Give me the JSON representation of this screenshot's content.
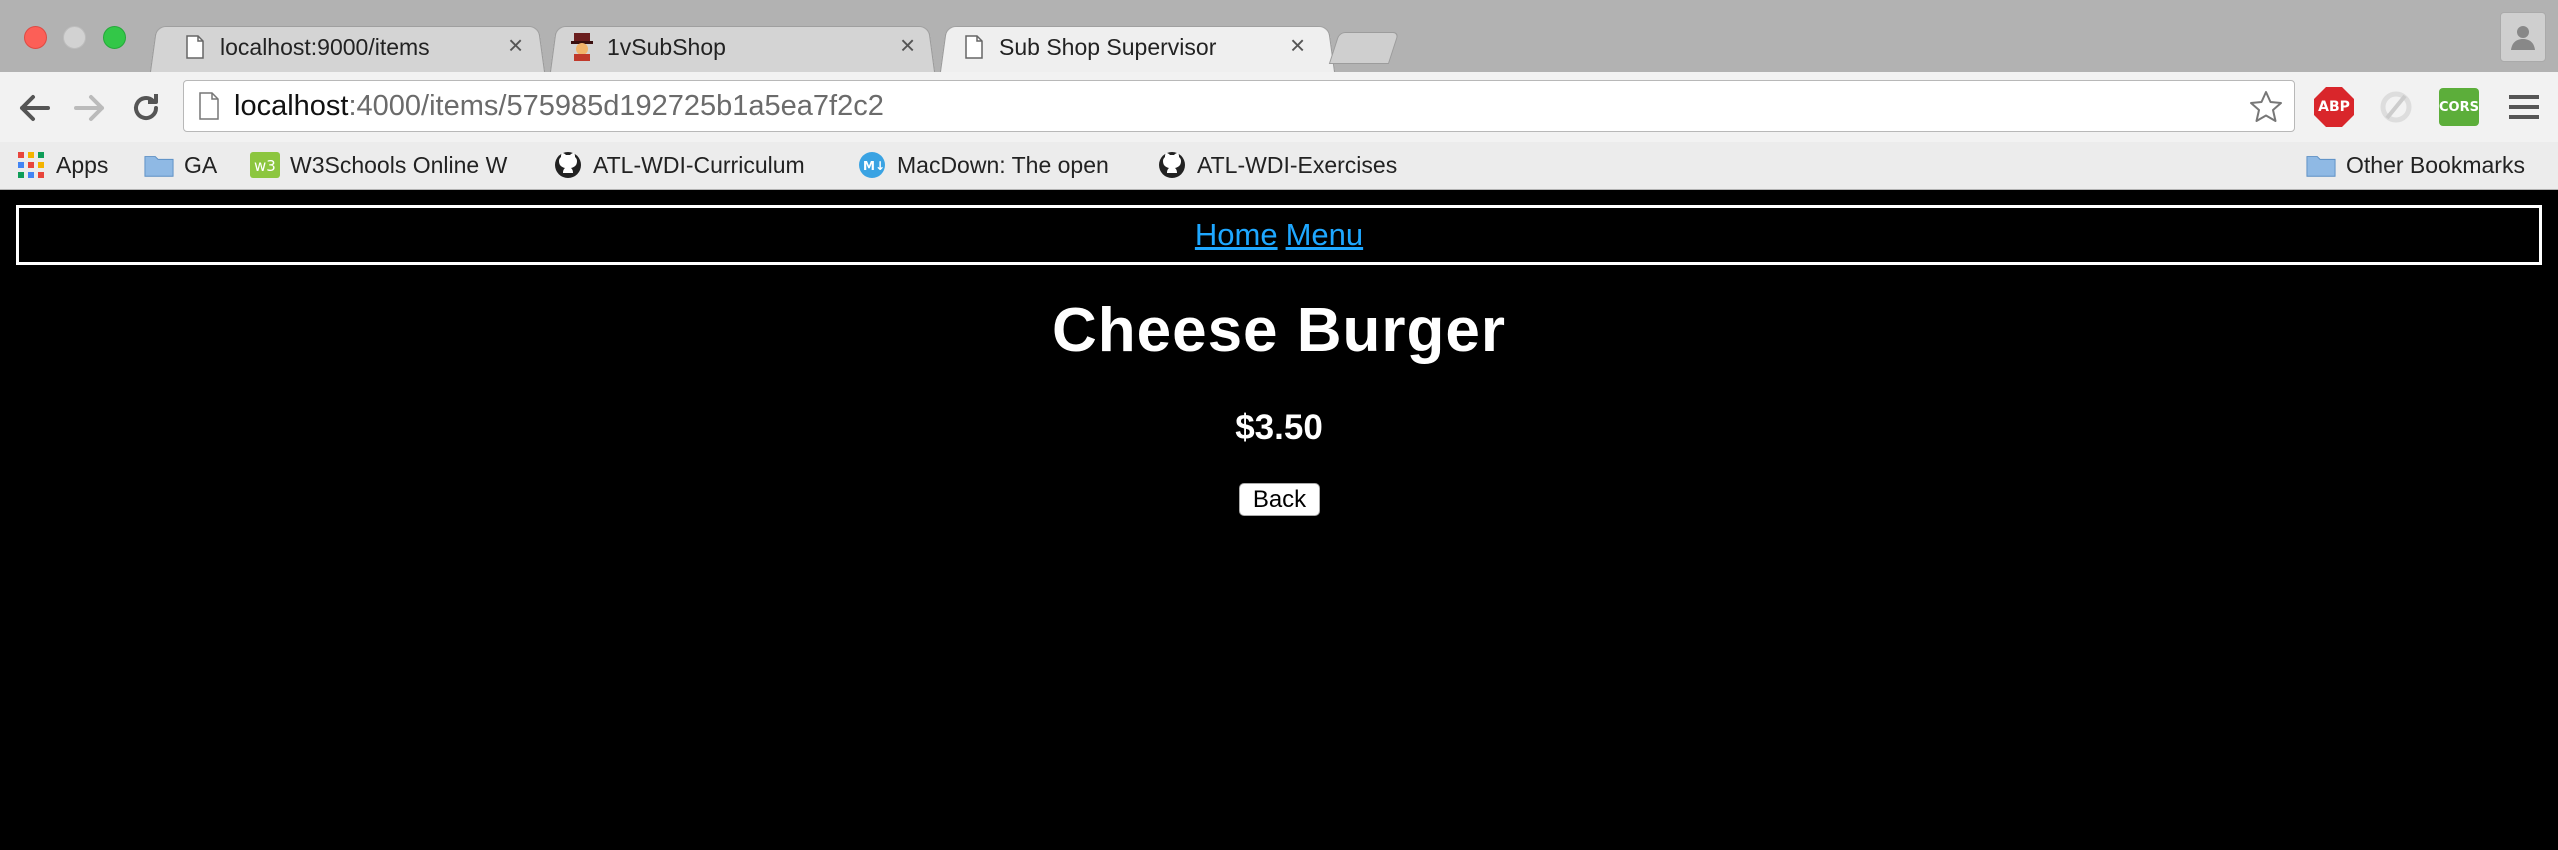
{
  "browser": {
    "tabs": [
      {
        "title": "localhost:9000/items",
        "icon": "page-icon",
        "active": false
      },
      {
        "title": "1vSubShop",
        "icon": "mascot-favicon",
        "active": false
      },
      {
        "title": "Sub Shop Supervisor",
        "icon": "page-icon",
        "active": true
      }
    ],
    "url_host": "localhost",
    "url_rest": ":4000/items/575985d192725b1a5ea7f2c2",
    "extensions": {
      "abp": "ABP",
      "cors": "CORS"
    },
    "bookmarks": [
      {
        "label": "Apps",
        "icon": "apps-grid-icon"
      },
      {
        "label": "GA",
        "icon": "folder-icon"
      },
      {
        "label": "W3Schools Online W",
        "icon": "w3schools-icon"
      },
      {
        "label": "ATL-WDI-Curriculum",
        "icon": "github-icon"
      },
      {
        "label": "MacDown: The open",
        "icon": "macdown-icon"
      },
      {
        "label": "ATL-WDI-Exercises",
        "icon": "github-icon"
      }
    ],
    "other_bookmarks": "Other Bookmarks"
  },
  "page": {
    "nav": {
      "home": "Home",
      "menu": "Menu"
    },
    "item_name": "Cheese Burger",
    "item_price": "$3.50",
    "back_label": "Back"
  },
  "colors": {
    "page_background": "#000000",
    "link": "#1ea7ff",
    "text": "#ffffff"
  }
}
